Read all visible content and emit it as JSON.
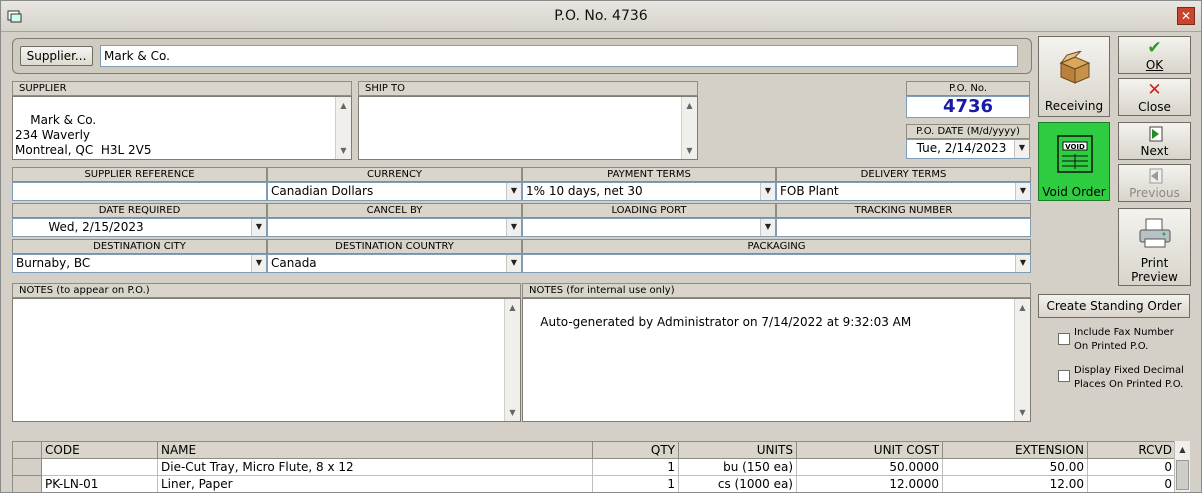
{
  "window": {
    "title": "P.O. No. 4736"
  },
  "supplier_bar": {
    "button_label": "Supplier...",
    "value": "Mark & Co."
  },
  "supplier": {
    "label": "SUPPLIER",
    "address": "Mark & Co.\n234 Waverly\nMontreal, QC  H3L 2V5"
  },
  "ship_to": {
    "label": "SHIP TO",
    "value": ""
  },
  "po_no": {
    "label": "P.O. No.",
    "value": "4736"
  },
  "po_date": {
    "label": "P.O. DATE (M/d/yyyy)",
    "value": "Tue, 2/14/2023"
  },
  "fields": {
    "supplier_reference": {
      "label": "SUPPLIER REFERENCE",
      "value": ""
    },
    "currency": {
      "label": "CURRENCY",
      "value": "Canadian Dollars"
    },
    "payment_terms": {
      "label": "PAYMENT TERMS",
      "value": "1% 10 days, net 30"
    },
    "delivery_terms": {
      "label": "DELIVERY TERMS",
      "value": "FOB Plant"
    },
    "date_required": {
      "label": "DATE REQUIRED",
      "value": "Wed, 2/15/2023"
    },
    "cancel_by": {
      "label": "CANCEL BY",
      "value": ""
    },
    "loading_port": {
      "label": "LOADING PORT",
      "value": ""
    },
    "tracking_number": {
      "label": "TRACKING NUMBER",
      "value": ""
    },
    "destination_city": {
      "label": "DESTINATION CITY",
      "value": "Burnaby, BC"
    },
    "destination_country": {
      "label": "DESTINATION COUNTRY",
      "value": "Canada"
    },
    "packaging": {
      "label": "PACKAGING",
      "value": ""
    }
  },
  "notes": {
    "public_label": "NOTES (to appear on P.O.)",
    "public_value": "",
    "internal_label": "NOTES (for internal use only)",
    "internal_value": "Auto-generated by Administrator on 7/14/2022 at 9:32:03 AM"
  },
  "actions": {
    "receiving": "Receiving",
    "void_order": "Void Order",
    "void_stamp": "VOID",
    "ok": "OK",
    "close": "Close",
    "next": "Next",
    "previous": "Previous",
    "print_preview_1": "Print",
    "print_preview_2": "Preview",
    "create_standing_order": "Create Standing Order"
  },
  "options": {
    "include_fax_1": "Include Fax Number",
    "include_fax_2": "On Printed P.O.",
    "fixed_decimal_1": "Display Fixed Decimal",
    "fixed_decimal_2": "Places On Printed P.O."
  },
  "colors": {
    "po_number": "#1a1aa8",
    "void_button": "#2ecc40",
    "ok_check": "#2a9a2a",
    "close_x": "#cc2222"
  },
  "table": {
    "columns": [
      "CODE",
      "NAME",
      "QTY",
      "UNITS",
      "UNIT COST",
      "EXTENSION",
      "RCVD"
    ],
    "rows": [
      {
        "code": "",
        "name": "Die-Cut Tray, Micro Flute, 8 x 12",
        "qty": "1",
        "units": "bu (150 ea)",
        "unit_cost": "50.0000",
        "extension": "50.00",
        "rcvd": "0"
      },
      {
        "code": "PK-LN-01",
        "name": "Liner, Paper",
        "qty": "1",
        "units": "cs (1000 ea)",
        "unit_cost": "12.0000",
        "extension": "12.00",
        "rcvd": "0"
      }
    ]
  }
}
